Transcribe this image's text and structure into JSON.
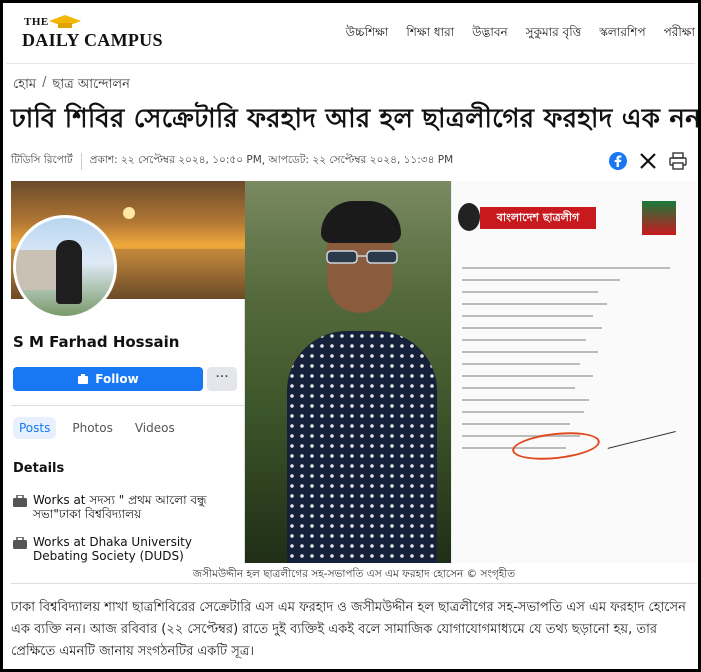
{
  "site": {
    "logo_the": "THE",
    "logo_main": "DAILY CAMPUS",
    "nav": [
      "উচ্চশিক্ষা",
      "শিক্ষা ধারা",
      "উদ্ভাবন",
      "সুকুমার বৃত্তি",
      "স্কলারশিপ",
      "পরীক্ষা"
    ]
  },
  "breadcrumb": {
    "home": "হোম",
    "separator": "/",
    "section": "ছাত্র আন্দোলন"
  },
  "article": {
    "title": "ঢাবি শিবির সেক্রেটারি ফরহাদ আর হল ছাত্রলীগের ফরহাদ এক নন",
    "author": "টিডিসি রিপোর্ট",
    "published": "প্রকাশ: ২২ সেপ্টেম্বর ২০২৪, ১০:৫০ PM",
    "updated": "আপডেট: ২২ সেপ্টেম্বর ২০২৪, ১১:৩৪ PM",
    "caption": "জসীমউদ্দীন হল ছাত্রলীগের সহ-সভাপতি এস এম ফরহাদ হোসেন  © সংগৃহীত",
    "body": "ঢাকা বিশ্ববিদ্যালয় শাখা ছাত্রশিবিরের সেক্রেটারি এস এম ফরহাদ ও জসীমউদ্দীন হল ছাত্রলীগের সহ-সভাপতি এস এম ফরহাদ হোসেন এক ব্যক্তি নন। আজ রবিবার (২২ সেপ্টেম্বর) রাতে দুই ব্যক্তিই একই বলে সামাজিক যোগাযোগমাধ্যমে যে তথ্য ছড়ানো হয়, তার প্রেক্ষিতে এমনটি জানায় সংগঠনটির একটি সূত্র।"
  },
  "share": {
    "icons": [
      "facebook-icon",
      "x-icon",
      "print-icon"
    ],
    "facebook_color": "#1877f2"
  },
  "facebook_card": {
    "name": "S M Farhad Hossain",
    "follow_label": "Follow",
    "more_label": "···",
    "tabs": [
      "Posts",
      "Photos",
      "Videos"
    ],
    "details_heading": "Details",
    "work_items": [
      "Works at সদস্য \" প্রথম আলো বন্ধু সভা\"ঢাকা বিশ্ববিদ্যালয়",
      "Works at Dhaka University Debating Society (DUDS)"
    ]
  },
  "document": {
    "banner": "বাংলাদেশ ছাত্রলীগ",
    "banner_color": "#c8191f"
  }
}
